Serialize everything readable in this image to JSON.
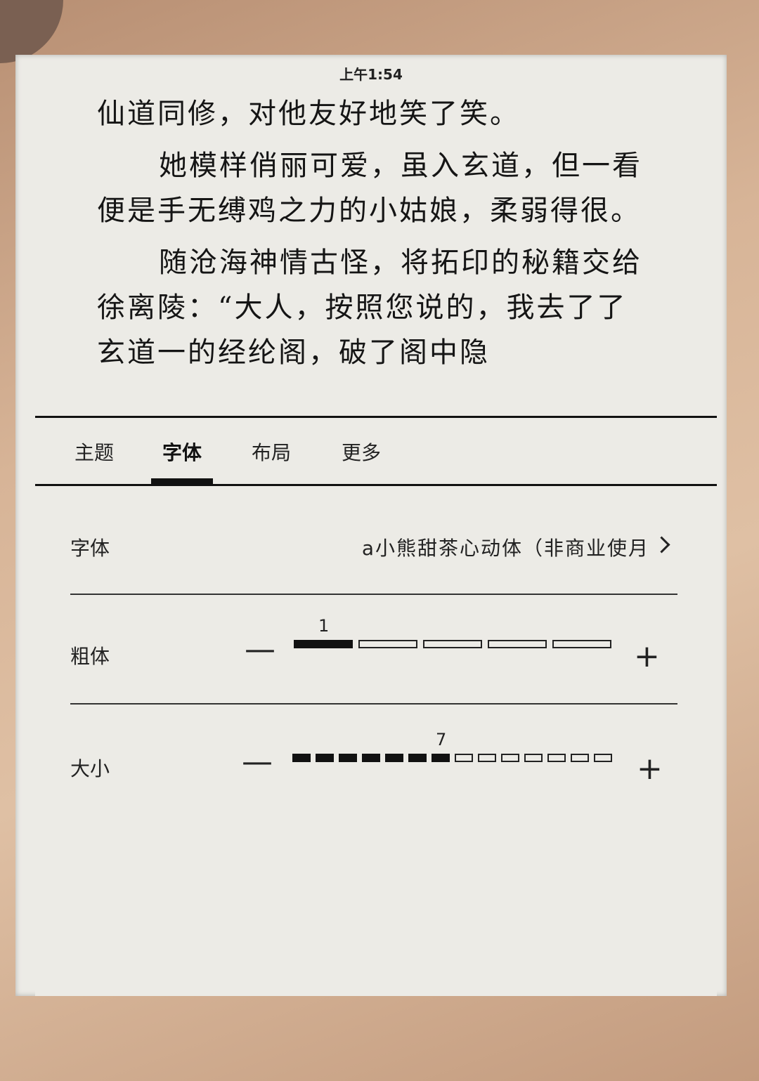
{
  "status_bar": {
    "time": "上午1:54"
  },
  "reading": {
    "paragraphs": [
      "仙道同修，对他友好地笑了笑。",
      "她模样俏丽可爱，虽入玄道，但一看便是手无缚鸡之力的小姑娘，柔弱得很。",
      "随沧海神情古怪，将拓印的秘籍交给徐离陵：“大人，按照您说的，我去了了玄道一的经纶阁，破了阁中隐"
    ]
  },
  "settings": {
    "tabs": [
      {
        "label": "主题"
      },
      {
        "label": "字体",
        "active": true
      },
      {
        "label": "布局"
      },
      {
        "label": "更多"
      }
    ],
    "font": {
      "label": "字体",
      "value": "a小熊甜茶心动体（非商业使月"
    },
    "bold": {
      "label": "粗体",
      "level": 1,
      "max": 5,
      "minus": "—",
      "plus": "+"
    },
    "size": {
      "label": "大小",
      "level": 7,
      "max": 14,
      "minus": "—",
      "plus": "+"
    }
  }
}
